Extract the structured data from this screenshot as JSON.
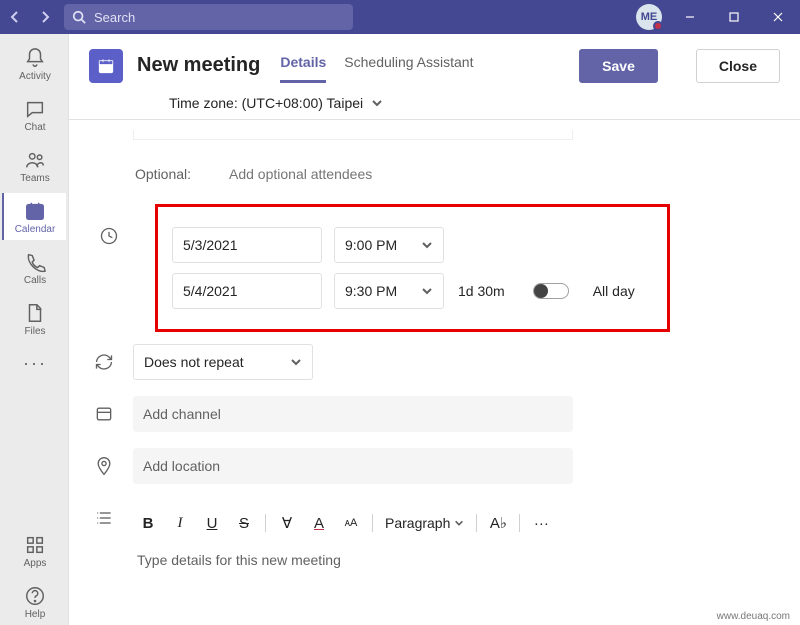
{
  "titlebar": {
    "search_placeholder": "Search",
    "avatar_initials": "ME"
  },
  "rail": {
    "activity": "Activity",
    "chat": "Chat",
    "teams": "Teams",
    "calendar": "Calendar",
    "calls": "Calls",
    "files": "Files",
    "apps": "Apps",
    "help": "Help"
  },
  "header": {
    "title": "New meeting",
    "tab_details": "Details",
    "tab_scheduling": "Scheduling Assistant",
    "save": "Save",
    "close": "Close"
  },
  "timezone": {
    "label": "Time zone: (UTC+08:00) Taipei"
  },
  "form": {
    "optional_label": "Optional:",
    "optional_placeholder": "Add optional attendees",
    "start_date": "5/3/2021",
    "start_time": "9:00 PM",
    "end_date": "5/4/2021",
    "end_time": "9:30 PM",
    "duration": "1d 30m",
    "all_day": "All day",
    "repeat": "Does not repeat",
    "add_channel": "Add channel",
    "add_location": "Add location",
    "paragraph_label": "Paragraph",
    "details_placeholder": "Type details for this new meeting"
  },
  "watermark": "www.deuaq.com"
}
